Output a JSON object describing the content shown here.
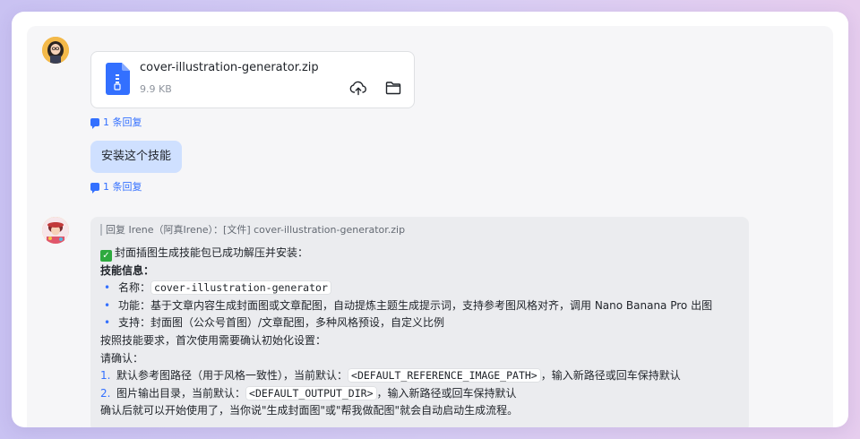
{
  "file_card": {
    "name": "cover-illustration-generator.zip",
    "size": "9.9 KB"
  },
  "reply_count_1": "1 条回复",
  "user_message": "安装这个技能",
  "reply_count_2": "1 条回复",
  "bot": {
    "quote": "回复 Irene（阿真Irene）：[文件] cover-illustration-generator.zip",
    "success_line": "封面插图生成技能包已成功解压并安装：",
    "info_header": "技能信息：",
    "name_label": "名称：",
    "name_value": "cover-illustration-generator",
    "function_line": "功能：基于文章内容生成封面图或文章配图，自动提炼主题生成提示词，支持参考图风格对齐，调用 Nano Banana Pro 出图",
    "support_line": "支持：封面图（公众号首图）/文章配图，多种风格预设，自定义比例",
    "requirement_line": "按照技能要求，首次使用需要确认初始化设置：",
    "confirm_header": "请确认：",
    "item1_num": "1.",
    "item1_prefix": "默认参考图路径（用于风格一致性），当前默认：",
    "item1_code": "<DEFAULT_REFERENCE_IMAGE_PATH>",
    "item1_suffix": "，输入新路径或回车保持默认",
    "item2_num": "2.",
    "item2_prefix": "图片输出目录，当前默认：",
    "item2_code": "<DEFAULT_OUTPUT_DIR>",
    "item2_suffix": "，输入新路径或回车保持默认",
    "closing_line": "确认后就可以开始使用了，当你说\"生成封面图\"或\"帮我做配图\"就会自动启动生成流程。"
  },
  "icons": {
    "file": "zip-file-icon",
    "upload": "cloud-upload-icon",
    "folder": "folder-icon",
    "reply": "comment-icon",
    "check": "check-mark-icon"
  },
  "colors": {
    "accent": "#3370ff",
    "user_bubble": "#cfe0ff",
    "bot_bubble": "#ebecef",
    "success": "#2eaa3f"
  }
}
